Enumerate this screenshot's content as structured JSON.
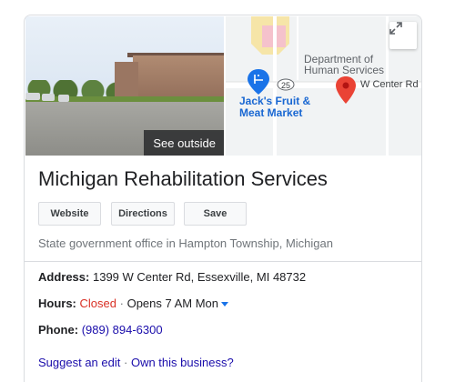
{
  "photo": {
    "overlay_label": "See outside"
  },
  "map": {
    "dept_label_line1": "Department of",
    "dept_label_line2": "Human Services",
    "road_shield": "25",
    "road_label": "W Center Rd",
    "poi_line1": "Jack's Fruit &",
    "poi_line2": "Meat Market",
    "expand_icon": "expand-icon"
  },
  "business": {
    "name": "Michigan Rehabilitation Services",
    "category": "State government office in Hampton Township, Michigan"
  },
  "actions": {
    "website": "Website",
    "directions": "Directions",
    "save": "Save"
  },
  "details": {
    "address_label": "Address:",
    "address_value": "1399 W Center Rd, Essexville, MI 48732",
    "hours_label": "Hours:",
    "hours_status": "Closed",
    "hours_sep": "·",
    "hours_next": "Opens 7 AM Mon",
    "phone_label": "Phone:",
    "phone_value": "(989) 894-6300"
  },
  "footer": {
    "suggest_edit": "Suggest an edit",
    "sep": "·",
    "own_business": "Own this business?"
  },
  "colors": {
    "link": "#1a0dab",
    "closed": "#d93025",
    "map_marker": "#ea4335",
    "poi_blue": "#1a73e8"
  }
}
